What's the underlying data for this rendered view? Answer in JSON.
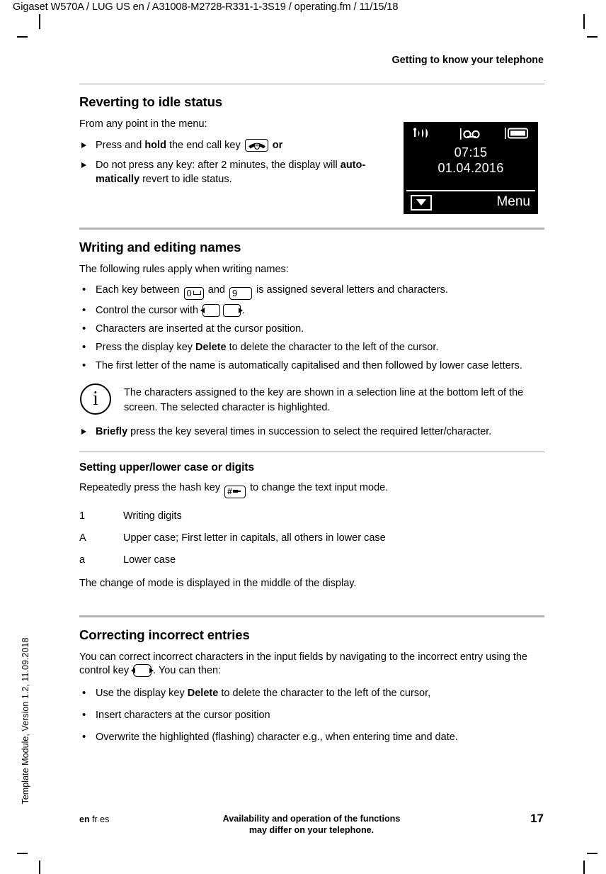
{
  "header": {
    "doc_path": "Gigaset W570A / LUG US en / A31008-M2728-R331-1-3S19 / operating.fm / 11/15/18",
    "chapter": "Getting to know your telephone"
  },
  "sections": [
    {
      "id": "reverting",
      "title": "Reverting to idle status",
      "intro": "From any point in the menu:",
      "items": [
        {
          "pre": "Press and ",
          "bold1": "hold",
          "mid": " the end call key ",
          "key": "end-call-key",
          "post": " or"
        },
        {
          "pre": "Do not press any key: after 2 minutes, the display will ",
          "bold1": "auto-matically",
          "post": " revert to idle status."
        }
      ]
    },
    {
      "id": "writing",
      "title": "Writing and editing names",
      "intro": "The following rules apply when writing names:",
      "bullets": [
        {
          "a": "Each key between ",
          "key1": "0",
          "b": " and ",
          "key2": "9",
          "c": " is assigned several letters and characters."
        },
        {
          "a": "Control the cursor with ",
          "c": "."
        },
        {
          "a": "Characters are inserted at the cursor position."
        },
        {
          "a": "Press the display key ",
          "bold": "Delete",
          "c": " to delete the character to the left of the cursor."
        },
        {
          "a": "The first letter of the name is automatically capitalised and then followed by lower case letters."
        }
      ],
      "note": {
        "icon": "info-icon",
        "glyph": "i",
        "text": "The characters assigned to the key are shown in a selection line at the bottom left of the screen. The selected character is highlighted."
      },
      "after_note": {
        "bold": "Briefly",
        "rest": " press the key several times in succession to select the required letter/character."
      }
    },
    {
      "id": "case",
      "title": "Setting upper/lower case or digits",
      "intro_pre": "Repeatedly press the hash key ",
      "intro_post": " to change the text input mode.",
      "modes": [
        {
          "term": "1",
          "desc": "Writing digits"
        },
        {
          "term": "A",
          "desc": "Upper case; First letter in capitals, all others in lower case"
        },
        {
          "term": "a",
          "desc": "Lower case"
        }
      ],
      "outro": "The change of mode is displayed in the middle of the display."
    },
    {
      "id": "correcting",
      "title": "Correcting incorrect entries",
      "intro_pre": "You can correct incorrect characters in the input fields by navigating to the incorrect entry using the control key ",
      "intro_post": ". You can then:",
      "bullets": [
        {
          "a": "Use the display key ",
          "bold": "Delete",
          "c": " to delete the character to the left of the cursor,"
        },
        {
          "a": "Insert characters at the cursor position"
        },
        {
          "a": "Overwrite the highlighted (flashing) character e.g., when entering time and date."
        }
      ]
    }
  ],
  "handset_display": {
    "signal_icon": "signal-strength-icon",
    "answering_machine_icon": "answering-machine-icon",
    "battery_icon": "battery-icon",
    "time": "07:15",
    "date": "01.04.2016",
    "softkey_left_icon": "message-envelope-icon",
    "softkey_right_label": "Menu",
    "background_color": "#000000",
    "text_color": "#ffffff"
  },
  "footer": {
    "langs_bold": "en",
    "langs_rest": " fr es",
    "note_line1": "Availability and operation of the functions",
    "note_line2": "may differ on your telephone.",
    "page_number": "17"
  },
  "sidebar": {
    "template_info": "Template Module, Version 1.2, 11.09.2018"
  }
}
